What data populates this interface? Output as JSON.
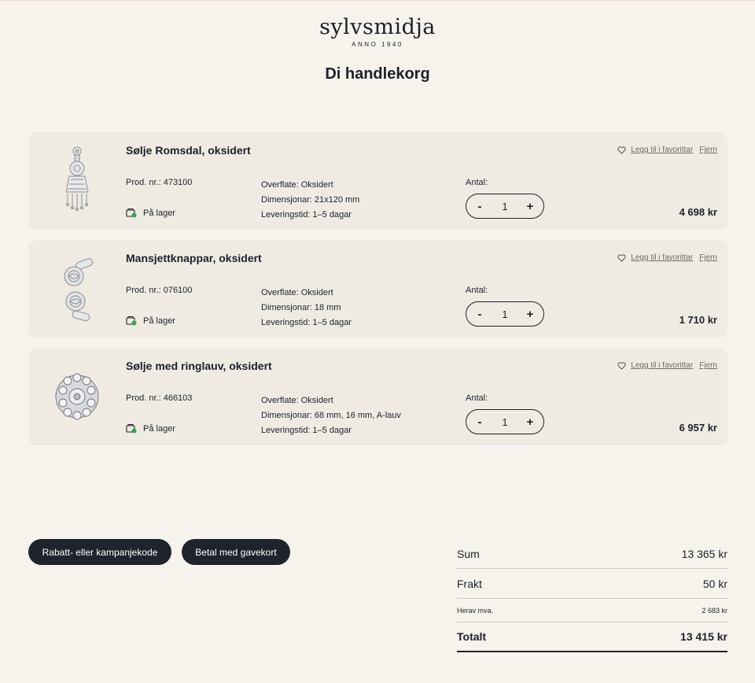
{
  "brand": {
    "name": "sylvsmidja",
    "tagline": "ANNO 1940"
  },
  "page": {
    "title": "Di handlekorg"
  },
  "labels": {
    "prod_nr": "Prod. nr.:",
    "in_stock": "På lager",
    "quantity": "Antal:",
    "favorite": "Legg til i favorittar",
    "remove": "Fjern",
    "minus": "-",
    "plus": "+"
  },
  "items": [
    {
      "title": "Sølje Romsdal, oksidert",
      "prod_nr": "473100",
      "surface": "Overflate: Oksidert",
      "dimensions": "Dimensjonar: 21x120 mm",
      "delivery": "Leveringstid: 1–5 dagar",
      "quantity": "1",
      "price": "4 698 kr",
      "image_icon": "brooch-romsdal-icon"
    },
    {
      "title": "Mansjettknappar, oksidert",
      "prod_nr": "076100",
      "surface": "Overflate: Oksidert",
      "dimensions": "Dimensjonar: 18 mm",
      "delivery": "Leveringstid: 1–5 dagar",
      "quantity": "1",
      "price": "1 710 kr",
      "image_icon": "cufflinks-icon"
    },
    {
      "title": "Sølje med ringlauv, oksidert",
      "prod_nr": "466103",
      "surface": "Overflate: Oksidert",
      "dimensions": "Dimensjonar: 68 mm, 16 mm, A-lauv",
      "delivery": "Leveringstid: 1–5 dagar",
      "quantity": "1",
      "price": "6 957 kr",
      "image_icon": "ring-leaf-brooch-icon"
    }
  ],
  "buttons": {
    "discount": "Rabatt- eller kampanjekode",
    "giftcard": "Betal med gavekort"
  },
  "summary": {
    "sum_label": "Sum",
    "sum_value": "13 365 kr",
    "shipping_label": "Frakt",
    "shipping_value": "50 kr",
    "vat_label": "Herav mva.",
    "vat_value": "2 683 kr",
    "total_label": "Totalt",
    "total_value": "13 415 kr"
  },
  "colors": {
    "background": "#f6f3ec",
    "card": "#efebe3",
    "dark": "#1f232b",
    "stock_green": "#3aa35a"
  }
}
